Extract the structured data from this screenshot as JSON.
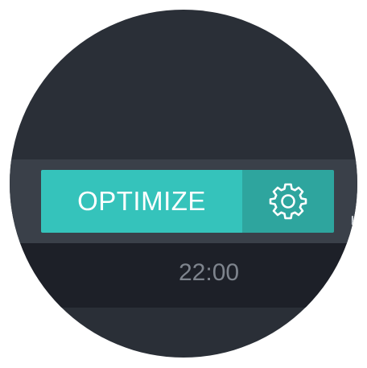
{
  "toolbar": {
    "optimize_label": "OPTIMIZE",
    "settings_icon": "gear-icon",
    "collapse_icon": "arrow-collapse-icon"
  },
  "timeline": {
    "labels": [
      ":00",
      "22:00"
    ]
  },
  "colors": {
    "accent": "#35c3bb",
    "accent_dark": "#2ea59e",
    "background": "#2a2f37",
    "toolbar": "#3a4049",
    "timeline": "#1d2028",
    "muted_text": "#7e848d"
  }
}
